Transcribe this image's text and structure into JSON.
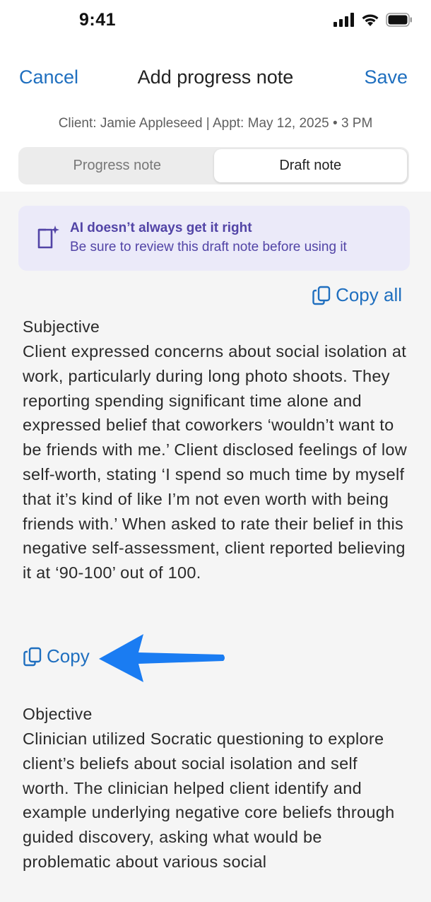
{
  "status": {
    "time": "9:41"
  },
  "nav": {
    "cancel": "Cancel",
    "title": "Add progress note",
    "save": "Save"
  },
  "client_info": "Client: Jamie Appleseed | Appt: May 12, 2025 • 3 PM",
  "tabs": [
    {
      "label": "Progress note",
      "active": false
    },
    {
      "label": "Draft note",
      "active": true
    }
  ],
  "ai_banner": {
    "title": "AI doesn’t always get it right",
    "subtitle": "Be sure to review this draft note before using it",
    "icon": "document-sparkle-icon"
  },
  "copy_all_label": "Copy all",
  "sections": [
    {
      "title": "Subjective",
      "body": "Client expressed concerns about social isolation at work, particularly during long photo shoots. They reporting spending significant time alone and expressed belief that coworkers ‘wouldn’t want to be friends with me.’ Client disclosed feelings of low self-worth, stating ‘I spend so much time by myself that it’s kind of like I’m not even worth with being friends with.’ When asked to rate their belief in this negative self-assessment, client reported believing it at ‘90-100’ out of 100.",
      "copy_label": "Copy"
    },
    {
      "title": "Objective",
      "body": "Clinician utilized Socratic questioning to explore client’s beliefs about social isolation and self worth. The clinician helped client identify and example underlying negative core beliefs through guided discovery, asking what would be problematic about various social"
    }
  ],
  "colors": {
    "link": "#1f6fbf",
    "ai_accent": "#5244a6",
    "ai_bg": "#ebeaf9",
    "arrow": "#1a7cf2"
  }
}
